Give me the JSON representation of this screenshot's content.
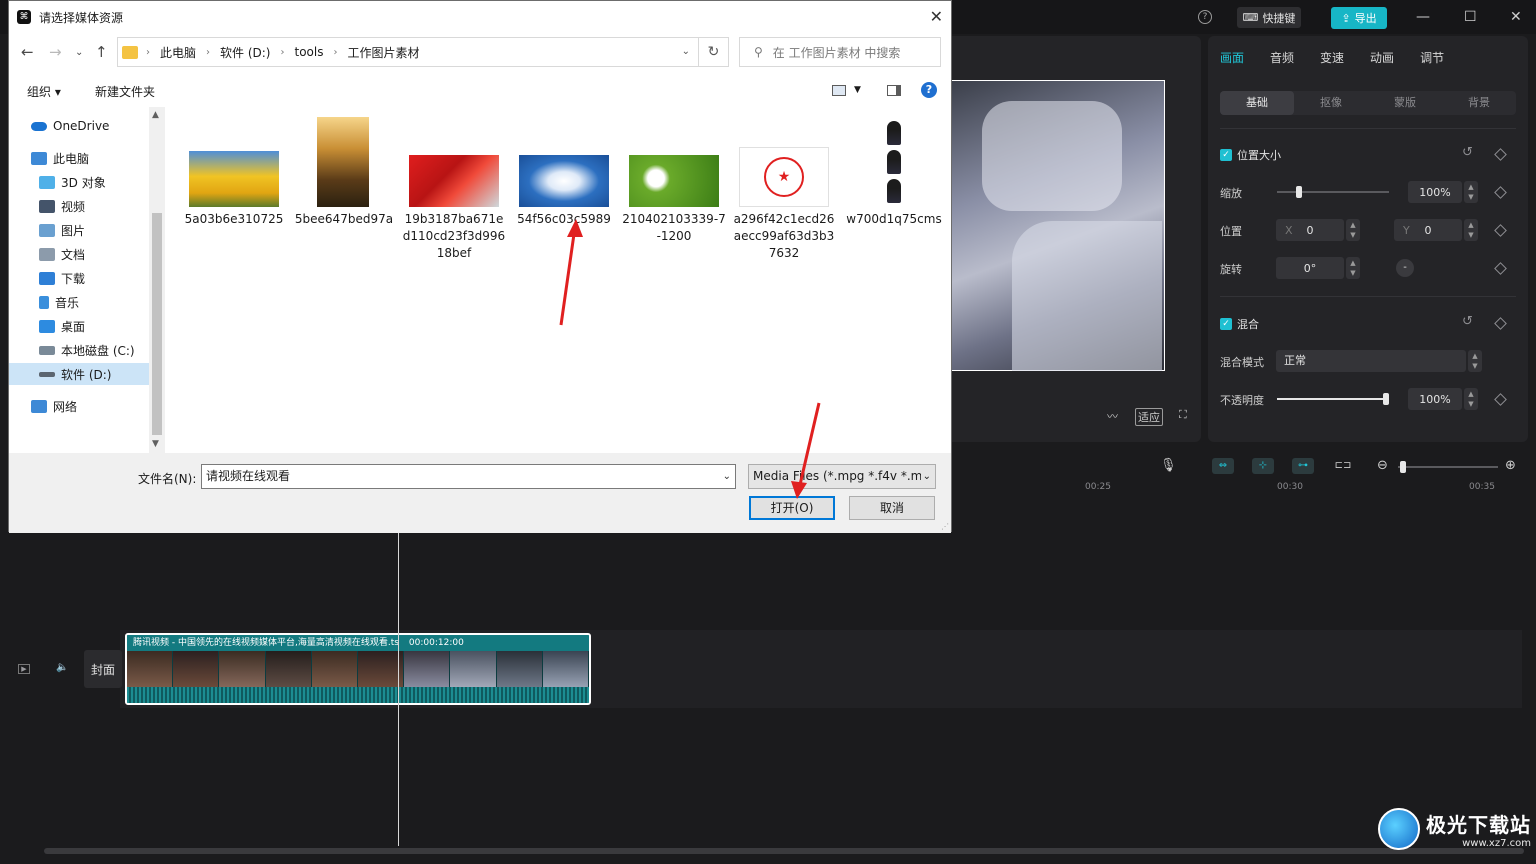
{
  "dialog": {
    "title": "请选择媒体资源",
    "breadcrumbs": [
      "此电脑",
      "软件 (D:)",
      "tools",
      "工作图片素材"
    ],
    "search_placeholder": "在 工作图片素材 中搜索",
    "toolbar": {
      "organize": "组织",
      "new_folder": "新建文件夹"
    },
    "nav_items": [
      {
        "label": "OneDrive",
        "icon": "onedrive-icon"
      },
      {
        "label": "此电脑",
        "icon": "computer-icon"
      },
      {
        "label": "3D 对象",
        "icon": "3d-objects-icon"
      },
      {
        "label": "视频",
        "icon": "video-icon"
      },
      {
        "label": "图片",
        "icon": "pictures-icon"
      },
      {
        "label": "文档",
        "icon": "documents-icon"
      },
      {
        "label": "下载",
        "icon": "download-icon"
      },
      {
        "label": "音乐",
        "icon": "music-icon"
      },
      {
        "label": "桌面",
        "icon": "desktop-icon"
      },
      {
        "label": "本地磁盘 (C:)",
        "icon": "drive-icon"
      },
      {
        "label": "软件 (D:)",
        "icon": "drive-icon"
      },
      {
        "label": "网络",
        "icon": "network-icon"
      }
    ],
    "files": [
      {
        "name": "5a03b6e310725"
      },
      {
        "name": "5bee647bed97a"
      },
      {
        "name": "19b3187ba671ed110cd23f3d99618bef"
      },
      {
        "name": "54f56c03c5989"
      },
      {
        "name": "210402103339-7-1200"
      },
      {
        "name": "a296f42c1ecd26aecc99af63d3b37632"
      },
      {
        "name": "w700d1q75cms"
      }
    ],
    "filename_label": "文件名(N):",
    "filename_value": "请视频在线观看",
    "filetype_value": "Media Files (*.mpg *.f4v *.mc",
    "open_label": "打开(O)",
    "cancel_label": "取消"
  },
  "editor": {
    "shortcut_label": "快捷键",
    "export_label": "导出",
    "tabs": [
      "画面",
      "音频",
      "变速",
      "动画",
      "调节"
    ],
    "sub_tabs": [
      "基础",
      "抠像",
      "蒙版",
      "背景"
    ],
    "section_position": "位置大小",
    "scale_label": "缩放",
    "scale_value": "100%",
    "scale_fraction": 0.2,
    "position_label": "位置",
    "pos_x_label": "X",
    "pos_x": "0",
    "pos_y_label": "Y",
    "pos_y": "0",
    "rotate_label": "旋转",
    "rotate_value": "0°",
    "section_blend": "混合",
    "blend_mode_label": "混合模式",
    "blend_mode_value": "正常",
    "opacity_label": "不透明度",
    "opacity_value": "100%",
    "opacity_fraction": 1.0,
    "fit_label": "适应",
    "ruler_marks": [
      "00:25",
      "00:30",
      "00:35"
    ],
    "cover_label": "封面",
    "clip_title": "腾讯视频 - 中国领先的在线视频媒体平台,海量高清视频在线观看.ts",
    "clip_duration": "00:00:12:00"
  },
  "watermark": {
    "text": "极光下载站",
    "url": "www.xz7.com"
  },
  "colors": {
    "accent": "#20c5d6",
    "dialog_select": "#cce4f7",
    "open_border": "#0078d7"
  }
}
